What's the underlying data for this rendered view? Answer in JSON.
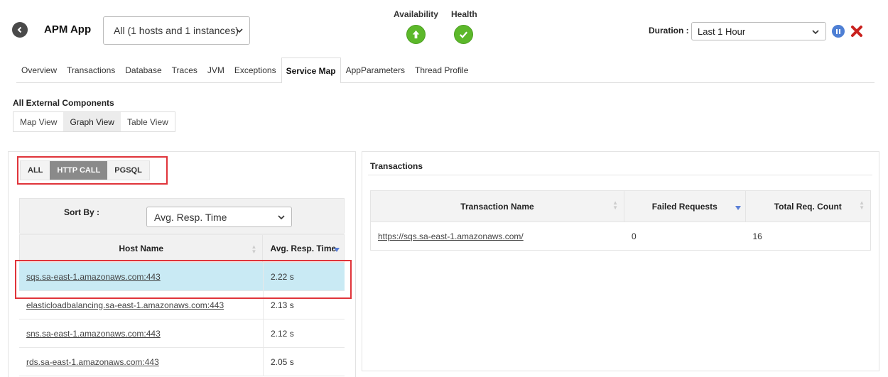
{
  "header": {
    "app_name": "APM App",
    "host_filter": "All (1 hosts and 1 instances)",
    "availability_label": "Availability",
    "health_label": "Health",
    "duration_label": "Duration :",
    "duration_value": "Last 1 Hour",
    "colors": {
      "status_ok": "#5cb82a",
      "pause": "#4e7fd4",
      "close": "#c9211e"
    }
  },
  "tabs": [
    {
      "label": "Overview",
      "active": false
    },
    {
      "label": "Transactions",
      "active": false
    },
    {
      "label": "Database",
      "active": false
    },
    {
      "label": "Traces",
      "active": false
    },
    {
      "label": "JVM",
      "active": false
    },
    {
      "label": "Exceptions",
      "active": false
    },
    {
      "label": "Service Map",
      "active": true
    },
    {
      "label": "AppParameters",
      "active": false
    },
    {
      "label": "Thread Profile",
      "active": false
    }
  ],
  "section": {
    "title": "All External Components",
    "views": [
      {
        "label": "Map View",
        "active": false
      },
      {
        "label": "Graph View",
        "active": true
      },
      {
        "label": "Table View",
        "active": false
      }
    ]
  },
  "filters": [
    {
      "label": "ALL",
      "active": false
    },
    {
      "label": "HTTP CALL",
      "active": true
    },
    {
      "label": "PGSQL",
      "active": false
    }
  ],
  "sort": {
    "label": "Sort By :",
    "value": "Avg. Resp. Time"
  },
  "host_table": {
    "columns": [
      "Host Name",
      "Avg. Resp. Time"
    ],
    "rows": [
      {
        "host": "sqs.sa-east-1.amazonaws.com:443",
        "time": "2.22 s",
        "selected": true
      },
      {
        "host": "elasticloadbalancing.sa-east-1.amazonaws.com:443",
        "time": "2.13 s",
        "selected": false
      },
      {
        "host": "sns.sa-east-1.amazonaws.com:443",
        "time": "2.12 s",
        "selected": false
      },
      {
        "host": "rds.sa-east-1.amazonaws.com:443",
        "time": "2.05 s",
        "selected": false
      }
    ]
  },
  "transactions": {
    "title": "Transactions",
    "columns": [
      "Transaction Name",
      "Failed Requests",
      "Total Req. Count"
    ],
    "rows": [
      {
        "name": "https://sqs.sa-east-1.amazonaws.com/",
        "failed": "0",
        "total": "16"
      }
    ]
  }
}
